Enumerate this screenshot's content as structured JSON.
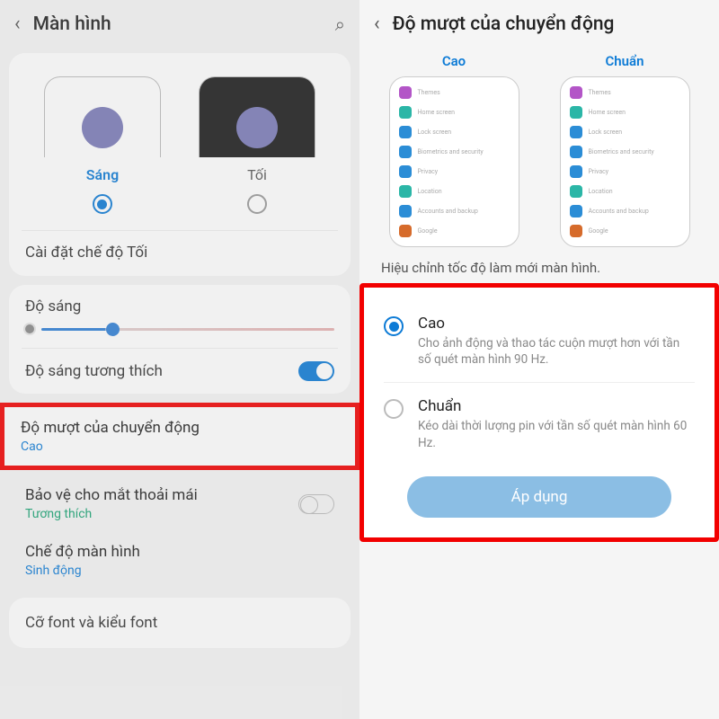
{
  "left": {
    "header": {
      "title": "Màn hình"
    },
    "theme": {
      "light": "Sáng",
      "dark": "Tối"
    },
    "dark_settings": "Cài đặt chế độ Tối",
    "brightness": "Độ sáng",
    "adaptive": "Độ sáng tương thích",
    "motion": {
      "title": "Độ mượt của chuyển động",
      "value": "Cao"
    },
    "eye": {
      "title": "Bảo vệ cho mắt thoải mái",
      "value": "Tương thích"
    },
    "screen_mode": {
      "title": "Chế độ màn hình",
      "value": "Sinh động"
    },
    "font": "Cỡ font và kiểu font"
  },
  "right": {
    "header": {
      "title": "Độ mượt của chuyển động"
    },
    "preview": {
      "high": "Cao",
      "standard": "Chuẩn"
    },
    "mini_items": [
      "Themes",
      "Home screen",
      "Lock screen",
      "Biometrics and security",
      "Privacy",
      "Location",
      "Accounts and backup",
      "Google"
    ],
    "mini_colors": [
      "#b355c7",
      "#2bb6a7",
      "#2b8dd6",
      "#2b8dd6",
      "#2b8dd6",
      "#2bb6a7",
      "#2b8dd6",
      "#d66b2b"
    ],
    "desc": "Hiệu chỉnh tốc độ làm mới màn hình.",
    "opt_high": {
      "title": "Cao",
      "desc": "Cho ảnh động và thao tác cuộn mượt hơn với tần số quét màn hình 90 Hz."
    },
    "opt_std": {
      "title": "Chuẩn",
      "desc": "Kéo dài thời lượng pin với tần số quét màn hình 60 Hz."
    },
    "apply": "Áp dụng"
  }
}
